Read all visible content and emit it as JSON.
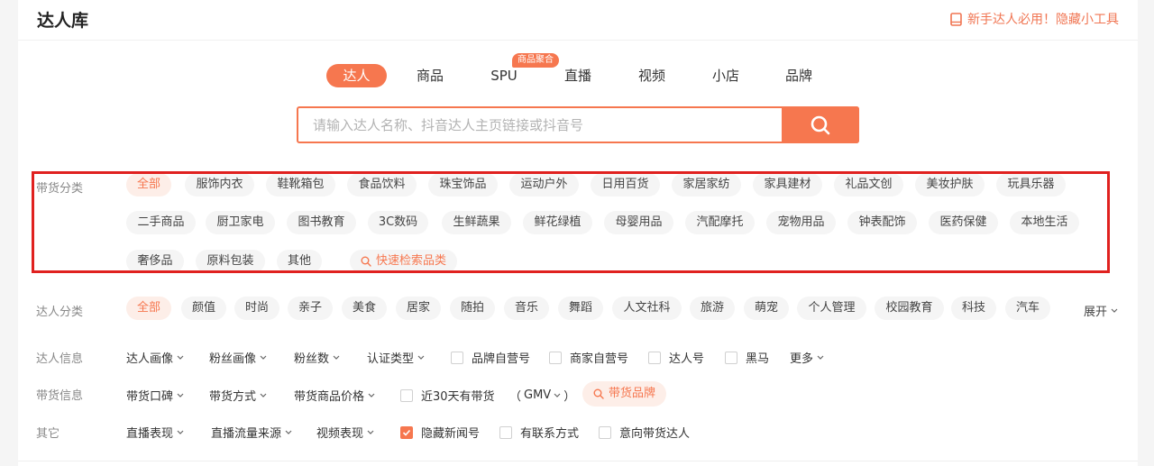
{
  "header": {
    "title": "达人库",
    "help_link": "新手达人必用！隐藏小工具"
  },
  "tabs": [
    {
      "label": "达人",
      "active": true
    },
    {
      "label": "商品"
    },
    {
      "label": "SPU"
    },
    {
      "label": "直播"
    },
    {
      "label": "视频"
    },
    {
      "label": "小店"
    },
    {
      "label": "品牌"
    }
  ],
  "spu_badge": "商品聚合",
  "search": {
    "placeholder": "请输入达人名称、抖音达人主页链接或抖音号",
    "value": ""
  },
  "goods_category": {
    "label": "带货分类",
    "items": [
      "全部",
      "服饰内衣",
      "鞋靴箱包",
      "食品饮料",
      "珠宝饰品",
      "运动户外",
      "日用百货",
      "家居家纺",
      "家具建材",
      "礼品文创",
      "美妆护肤",
      "玩具乐器",
      "二手商品",
      "厨卫家电",
      "图书教育",
      "3C数码",
      "生鲜蔬果",
      "鲜花绿植",
      "母婴用品",
      "汽配摩托",
      "宠物用品",
      "钟表配饰",
      "医药保健",
      "本地生活",
      "奢侈品",
      "原料包装",
      "其他"
    ],
    "quick_search": "快速检索品类"
  },
  "creator_category": {
    "label": "达人分类",
    "items": [
      "全部",
      "颜值",
      "时尚",
      "亲子",
      "美食",
      "居家",
      "随拍",
      "音乐",
      "舞蹈",
      "人文社科",
      "旅游",
      "萌宠",
      "个人管理",
      "校园教育",
      "科技",
      "汽车"
    ],
    "expand": "展开"
  },
  "creator_info": {
    "label": "达人信息",
    "dropdowns": [
      "达人画像",
      "粉丝画像",
      "粉丝数",
      "认证类型"
    ],
    "checkboxes": [
      {
        "label": "品牌自营号",
        "checked": false
      },
      {
        "label": "商家自营号",
        "checked": false
      },
      {
        "label": "达人号",
        "checked": false
      },
      {
        "label": "黑马",
        "checked": false
      }
    ],
    "more": "更多"
  },
  "sales_info": {
    "label": "带货信息",
    "dropdowns": [
      "带货口碑",
      "带货方式",
      "带货商品价格"
    ],
    "checkbox": {
      "label": "近30天有带货",
      "checked": false
    },
    "gmv_open": "（",
    "gmv_label": "GMV",
    "gmv_close": "）",
    "brand_button": "带货品牌"
  },
  "other": {
    "label": "其它",
    "dropdowns": [
      "直播表现",
      "直播流量来源",
      "视频表现"
    ],
    "checkboxes": [
      {
        "label": "隐藏新闻号",
        "checked": true
      },
      {
        "label": "有联系方式",
        "checked": false
      },
      {
        "label": "意向带货达人",
        "checked": false
      }
    ]
  },
  "colors": {
    "accent": "#f6774f",
    "highlight_frame": "#e0211f"
  },
  "icons": [
    "book-icon",
    "search-icon",
    "chevron-down-icon",
    "check-icon"
  ]
}
